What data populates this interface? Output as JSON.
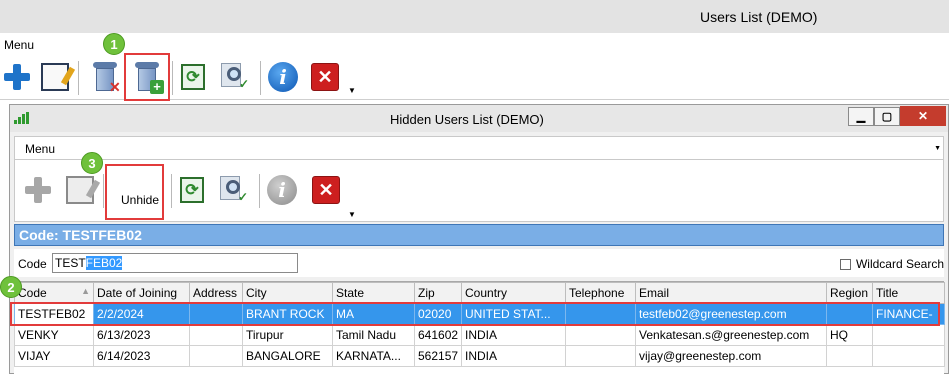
{
  "outer_window": {
    "title": "Users List (DEMO)",
    "menu_label": "Menu",
    "toolbar_icons": [
      "plus-icon",
      "edit-icon",
      "delete-bin-icon",
      "add-bin-icon",
      "refresh-icon",
      "search-icon",
      "info-icon",
      "close-icon"
    ]
  },
  "callouts": {
    "step1": "1",
    "step2": "2",
    "step3": "3"
  },
  "inner_window": {
    "title": "Hidden Users List (DEMO)",
    "menu_label": "Menu",
    "minimize": "▁",
    "maximize": "▢",
    "close": "✕",
    "unhide_label": "Unhide",
    "header_bar": "Code: TESTFEB02",
    "search": {
      "label": "Code",
      "value_plain": "TEST",
      "value_selected": "FEB02",
      "wildcard_label": "Wildcard Search"
    }
  },
  "grid": {
    "columns": [
      "Code",
      "Date of Joining",
      "Address",
      "City",
      "State",
      "Zip",
      "Country",
      "Telephone",
      "Email",
      "Region",
      "Title"
    ],
    "rows": [
      [
        "TESTFEB02",
        "2/2/2024",
        "",
        "BRANT ROCK",
        "MA",
        "02020",
        "UNITED STAT...",
        "",
        "testfeb02@greenestep.com",
        "",
        "FINANCE-"
      ],
      [
        "VENKY",
        "6/13/2023",
        "",
        "Tirupur",
        "Tamil Nadu",
        "641602",
        "INDIA",
        "",
        "Venkatesan.s@greenestep.com",
        "HQ",
        ""
      ],
      [
        "VIJAY",
        "6/14/2023",
        "",
        "BANGALORE",
        "KARNATA...",
        "562157",
        "INDIA",
        "",
        "vijay@greenestep.com",
        "",
        ""
      ]
    ]
  }
}
